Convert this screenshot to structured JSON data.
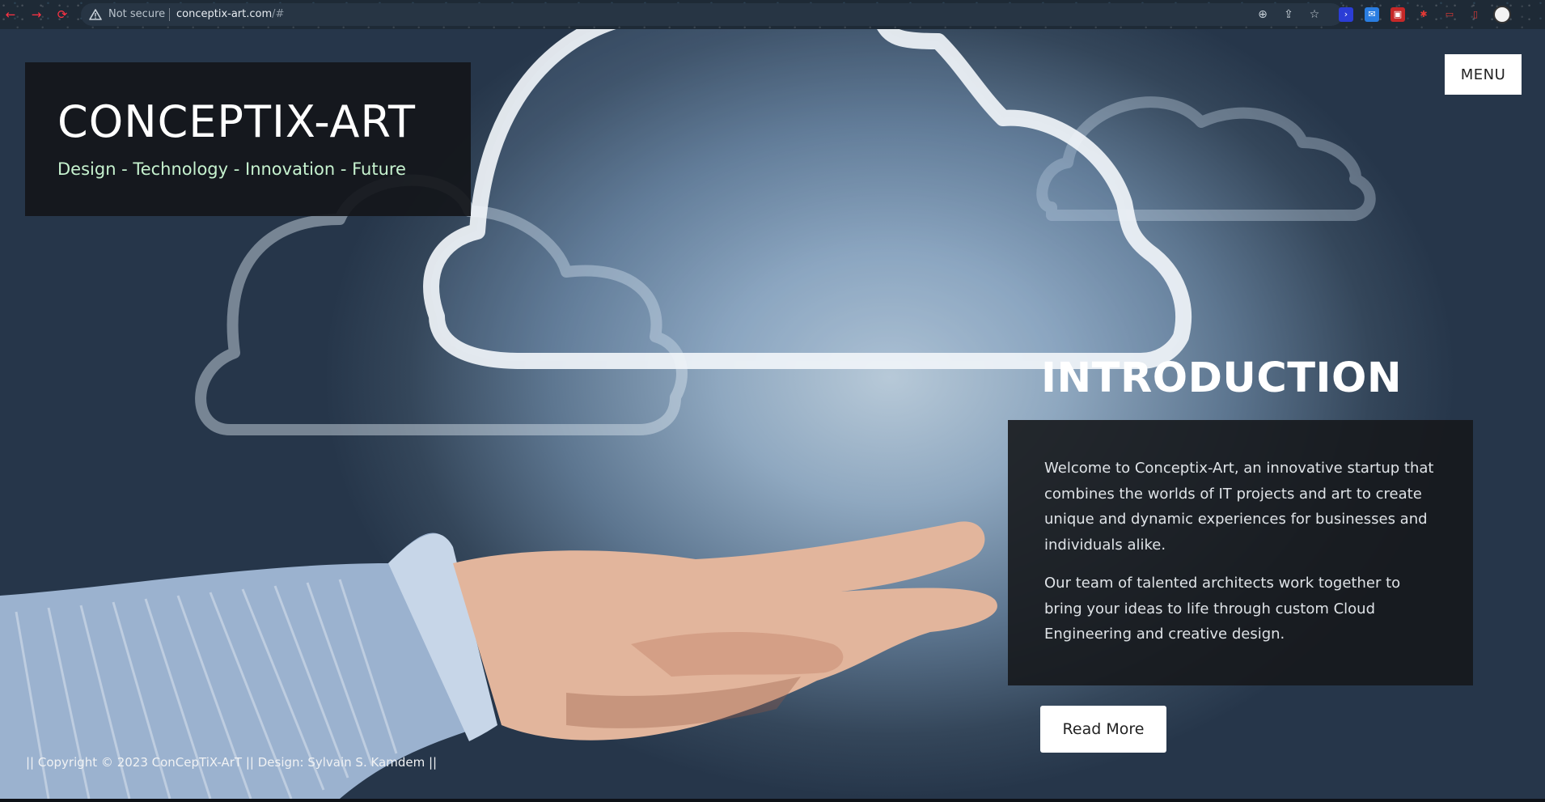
{
  "browser": {
    "security_label": "Not secure",
    "url_domain": "conceptix-art.com",
    "url_path": "/#"
  },
  "header": {
    "title": "CONCEPTIX-ART",
    "tagline": "Design - Technology - Innovation - Future"
  },
  "nav": {
    "menu_label": "MENU"
  },
  "intro": {
    "heading": "INTRODUCTION",
    "paragraphs": [
      "Welcome to Conceptix-Art, an innovative startup that combines the worlds of IT projects and art to create unique and dynamic experiences for businesses and individuals alike.",
      "Our team of talented architects work together to bring your ideas to life through custom Cloud Engineering and creative design."
    ],
    "read_more_label": "Read More"
  },
  "footer": {
    "copyright": "|| Copyright © 2023 ConCepTiX-ArT || Design: Sylvain S. Kamdem ||"
  },
  "colors": {
    "panel_bg": "#16181c",
    "tagline": "#c6f2cf",
    "button_bg": "#ffffff"
  }
}
